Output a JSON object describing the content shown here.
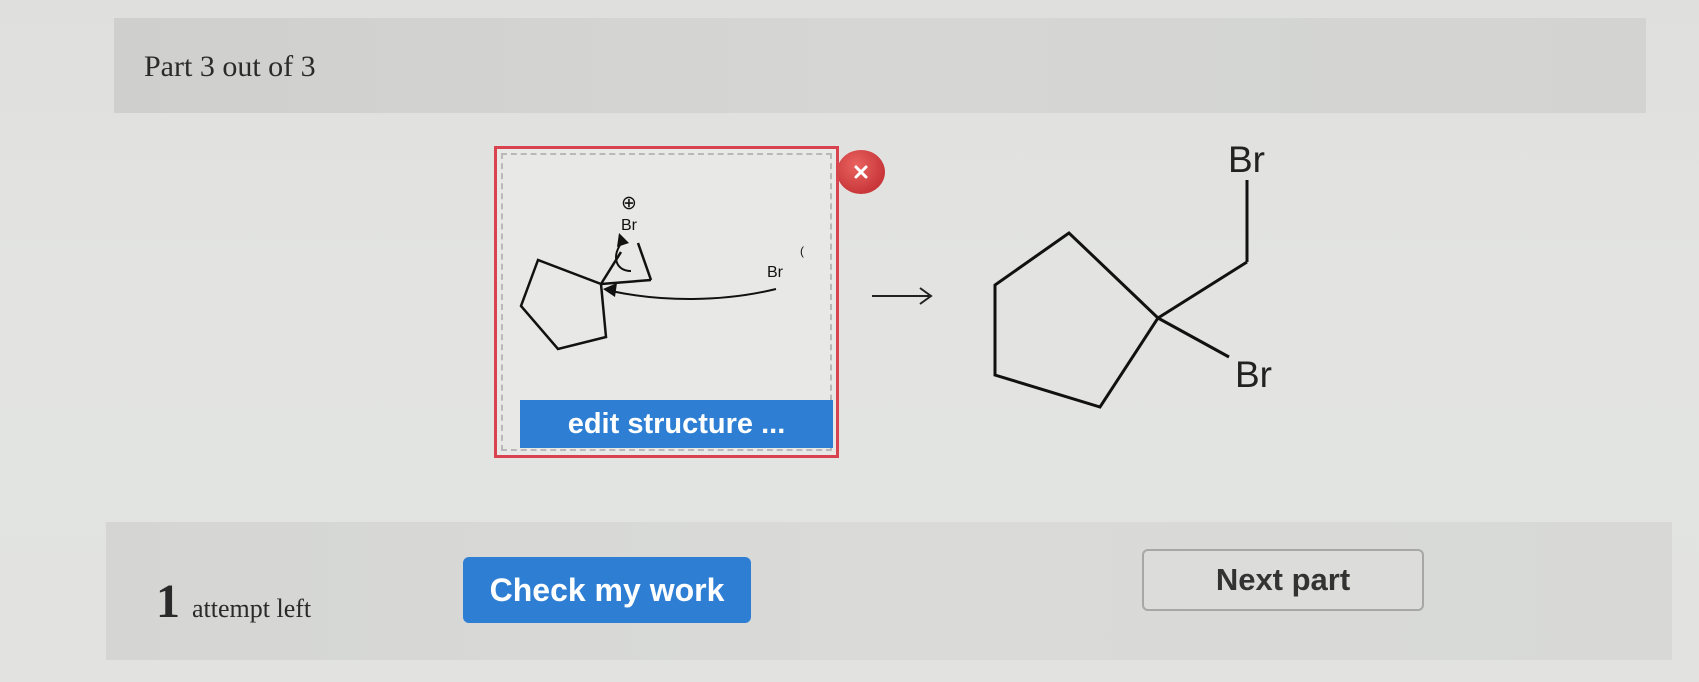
{
  "header": {
    "title": "Part 3 out of 3"
  },
  "answer_box": {
    "mechanism_labels": {
      "charge": "⊕",
      "bromonium_br": "Br",
      "bromide_br": "Br",
      "bromide_charge": "("
    },
    "edit_label": "edit structure ...",
    "remove_icon": "close-icon",
    "accent_color": "#d9434f"
  },
  "reaction": {
    "arrow": "→"
  },
  "product": {
    "top_br": "Br",
    "bottom_br": "Br"
  },
  "footer": {
    "attempt_count": "1",
    "attempt_label": "attempt left",
    "check_label": "Check my work",
    "next_label": "Next part"
  },
  "colors": {
    "primary_button": "#2e7fd4",
    "secondary_button": "#dcdddb"
  }
}
